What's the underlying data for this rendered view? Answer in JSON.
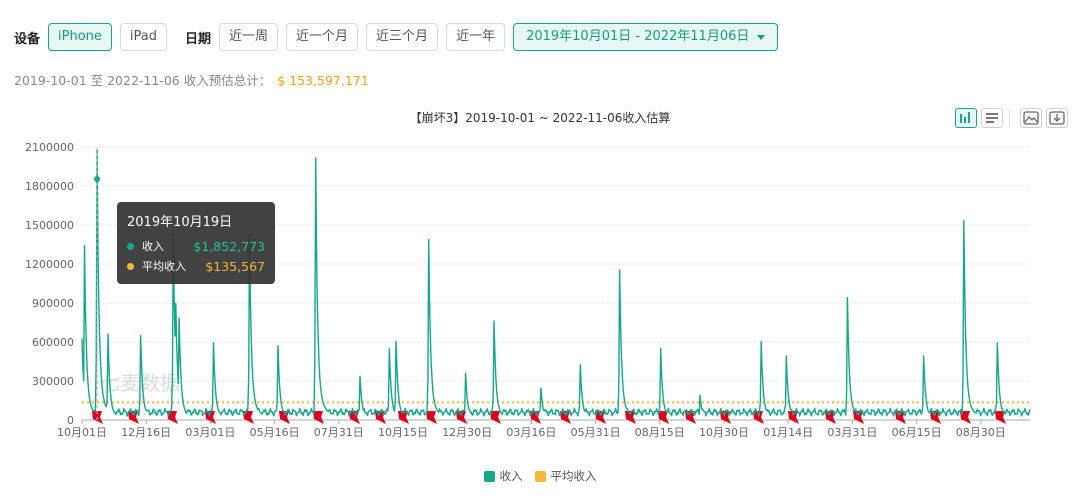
{
  "filters": {
    "device_label": "设备",
    "devices": [
      "iPhone",
      "iPad"
    ],
    "date_label": "日期",
    "ranges": [
      "近一周",
      "近一个月",
      "近三个月",
      "近一年"
    ],
    "date_range": "2019年10月01日 - 2022年11月06日"
  },
  "summary": {
    "text": "2019-10-01 至 2022-11-06 收入预估总计：",
    "total": "$ 153,597,171"
  },
  "tooltip": {
    "date": "2019年10月19日",
    "revenue_label": "收入",
    "revenue_value": "$1,852,773",
    "avg_label": "平均收入",
    "avg_value": "$135,567"
  },
  "watermark": "七麦数据",
  "colors": {
    "revenue": "#13a88a",
    "average": "#f5b73a",
    "flag": "#e0001b"
  },
  "icons": [
    "bar-chart-icon",
    "list-icon",
    "image-icon",
    "download-icon"
  ],
  "chart_data": {
    "type": "line",
    "title": "【崩坏3】2019-10-01 ~ 2022-11-06收入估算",
    "x_start": "2019-10-01",
    "x_end": "2022-11-06",
    "xtick_labels": [
      "10月01日",
      "12月16日",
      "03月01日",
      "05月16日",
      "07月31日",
      "10月15日",
      "12月30日",
      "03月16日",
      "05月31日",
      "08月15日",
      "10月30日",
      "01月14日",
      "03月31日",
      "06月15日",
      "08月30日"
    ],
    "ytick_labels": [
      "0",
      "300000",
      "600000",
      "900000",
      "1200000",
      "1500000",
      "1800000",
      "2100000"
    ],
    "ylim": [
      0,
      2100000
    ],
    "grid": true,
    "legend_position": "bottom",
    "series": [
      {
        "name": "收入",
        "baseline": 60000,
        "peaks": [
          {
            "x": "2019-10-01",
            "y": 560000
          },
          {
            "x": "2019-10-04",
            "y": 1200000
          },
          {
            "x": "2019-10-19",
            "y": 1852773
          },
          {
            "x": "2019-11-01",
            "y": 590000
          },
          {
            "x": "2019-12-10",
            "y": 580000
          },
          {
            "x": "2020-01-18",
            "y": 1280000
          },
          {
            "x": "2020-01-21",
            "y": 800000
          },
          {
            "x": "2020-01-25",
            "y": 700000
          },
          {
            "x": "2020-03-06",
            "y": 530000
          },
          {
            "x": "2020-04-18",
            "y": 1280000
          },
          {
            "x": "2020-05-22",
            "y": 510000
          },
          {
            "x": "2020-07-06",
            "y": 1800000
          },
          {
            "x": "2020-08-28",
            "y": 300000
          },
          {
            "x": "2020-10-02",
            "y": 490000
          },
          {
            "x": "2020-10-10",
            "y": 540000
          },
          {
            "x": "2020-11-18",
            "y": 1240000
          },
          {
            "x": "2021-01-01",
            "y": 320000
          },
          {
            "x": "2021-02-04",
            "y": 680000
          },
          {
            "x": "2021-04-01",
            "y": 220000
          },
          {
            "x": "2021-05-18",
            "y": 380000
          },
          {
            "x": "2021-07-04",
            "y": 1030000
          },
          {
            "x": "2021-08-22",
            "y": 490000
          },
          {
            "x": "2021-10-08",
            "y": 170000
          },
          {
            "x": "2021-12-20",
            "y": 540000
          },
          {
            "x": "2022-01-19",
            "y": 440000
          },
          {
            "x": "2022-04-02",
            "y": 840000
          },
          {
            "x": "2022-07-02",
            "y": 440000
          },
          {
            "x": "2022-08-19",
            "y": 1370000
          },
          {
            "x": "2022-09-28",
            "y": 530000
          }
        ]
      },
      {
        "name": "平均收入",
        "value": 135567
      }
    ],
    "tooltip_x": "2019-10-19"
  }
}
